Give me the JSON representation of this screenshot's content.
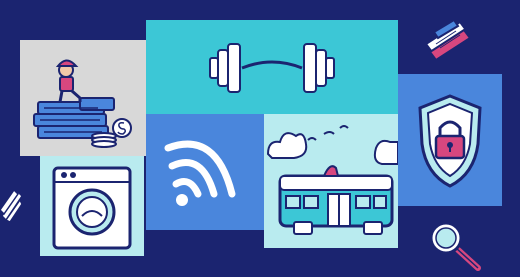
{
  "scene": {
    "background_color": "#1b2470",
    "tiles": [
      {
        "name": "money-stack-tile",
        "icon": "person-on-money-icon",
        "color": "#d8d8d8"
      },
      {
        "name": "dumbbell-tile",
        "icon": "dumbbell-icon",
        "color": "#3cc7d6"
      },
      {
        "name": "security-shield-tile",
        "icon": "shield-lock-icon",
        "color": "#4a86dc"
      },
      {
        "name": "washing-machine-tile",
        "icon": "washing-machine-icon",
        "color": "#b9ebef"
      },
      {
        "name": "wifi-tile",
        "icon": "wifi-icon",
        "color": "#4a86dc"
      },
      {
        "name": "bus-tile",
        "icon": "bus-icon",
        "color": "#b9ebef"
      }
    ],
    "floating_icons": [
      {
        "name": "books-icon"
      },
      {
        "name": "paper-fan-icon"
      },
      {
        "name": "magnifier-icon"
      }
    ],
    "colors": {
      "dark_outline": "#1b2470",
      "accent_pink": "#d7477f",
      "accent_cyan": "#3cc7d6",
      "white": "#ffffff"
    }
  }
}
